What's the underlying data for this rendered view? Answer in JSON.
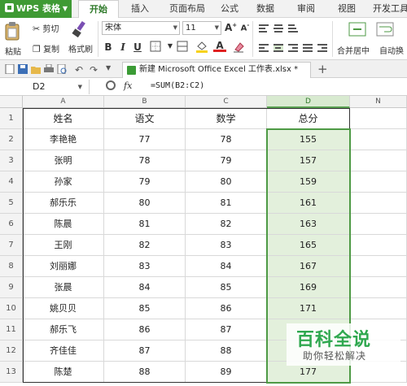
{
  "app": {
    "name": "WPS 表格",
    "icon": "wps-logo-icon"
  },
  "menu_tabs": [
    "开始",
    "插入",
    "页面布局",
    "公式",
    "数据",
    "审阅",
    "视图",
    "开发工具"
  ],
  "active_tab": "开始",
  "ribbon": {
    "paste": "粘贴",
    "cut": "剪切",
    "copy": "复制",
    "format_painter": "格式刷",
    "font_name": "宋体",
    "font_size": "11",
    "merge_center": "合并居中",
    "auto_wrap": "自动换"
  },
  "document": {
    "tab_title": "新建 Microsoft Office Excel 工作表.xlsx *",
    "dirty": "*"
  },
  "formula_bar": {
    "cell_ref": "D2",
    "fx": "fx",
    "formula": "=SUM(B2:C2)"
  },
  "sheet": {
    "columns": [
      "A",
      "B",
      "C",
      "D",
      "N"
    ],
    "selected_column": "D",
    "headers": [
      "姓名",
      "语文",
      "数学",
      "总分"
    ],
    "rows": [
      {
        "n": "2",
        "name": "李艳艳",
        "chinese": "77",
        "math": "78",
        "total": "155"
      },
      {
        "n": "3",
        "name": "张明",
        "chinese": "78",
        "math": "79",
        "total": "157"
      },
      {
        "n": "4",
        "name": "孙家",
        "chinese": "79",
        "math": "80",
        "total": "159"
      },
      {
        "n": "5",
        "name": "郝乐乐",
        "chinese": "80",
        "math": "81",
        "total": "161"
      },
      {
        "n": "6",
        "name": "陈晨",
        "chinese": "81",
        "math": "82",
        "total": "163"
      },
      {
        "n": "7",
        "name": "王刚",
        "chinese": "82",
        "math": "83",
        "total": "165"
      },
      {
        "n": "8",
        "name": "刘丽娜",
        "chinese": "83",
        "math": "84",
        "total": "167"
      },
      {
        "n": "9",
        "name": "张晨",
        "chinese": "84",
        "math": "85",
        "total": "169"
      },
      {
        "n": "10",
        "name": "姚贝贝",
        "chinese": "85",
        "math": "86",
        "total": "171"
      },
      {
        "n": "11",
        "name": "郝乐飞",
        "chinese": "86",
        "math": "87",
        "total": ""
      },
      {
        "n": "12",
        "name": "齐佳佳",
        "chinese": "87",
        "math": "88",
        "total": ""
      },
      {
        "n": "13",
        "name": "陈楚",
        "chinese": "88",
        "math": "89",
        "total": "177"
      }
    ]
  },
  "watermark": {
    "title": "百科全说",
    "subtitle": "助你轻松解决"
  },
  "colors": {
    "accent": "#3f9a34",
    "selection": "#e3f0dc",
    "watermark": "#2fa84f"
  }
}
